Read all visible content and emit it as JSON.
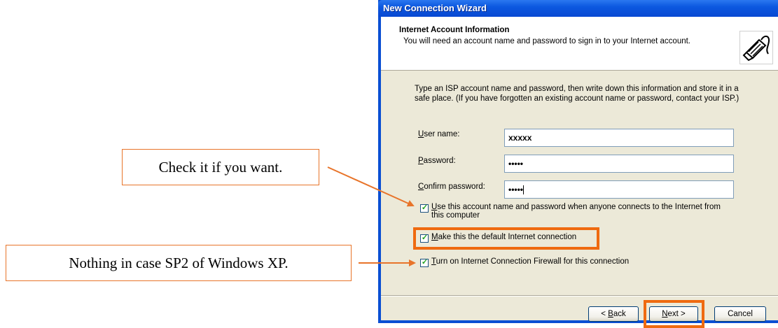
{
  "callouts": {
    "check_it": "Check it if you want.",
    "nothing_sp2": "Nothing in case SP2 of Windows XP."
  },
  "window": {
    "title": "New Connection Wizard"
  },
  "header": {
    "title": "Internet Account Information",
    "subtitle": "You will need an account name and password to sign in to your Internet account.",
    "icon": "phone-cable-icon"
  },
  "intro": {
    "line1": "Type an ISP account name and password, then write down this information and store it in a",
    "line2": "safe place. (If you have forgotten an existing account name or password, contact your ISP.)"
  },
  "fields": {
    "user_name": {
      "label_first": "U",
      "label_rest": "ser name:",
      "value": "xxxxx"
    },
    "password": {
      "label_first": "P",
      "label_rest": "assword:",
      "value": "•••••"
    },
    "confirm": {
      "label_first": "C",
      "label_rest": "onfirm password:",
      "value": "•••••"
    }
  },
  "checks": {
    "use_account": {
      "checked": true,
      "line1_first": "U",
      "line1_rest": "se this account  name and password when anyone connects to the Internet from",
      "line2": "this computer"
    },
    "default_connection": {
      "checked": true,
      "first": "M",
      "rest": "ake this the default Internet connection"
    },
    "firewall": {
      "checked": true,
      "first": "T",
      "rest": "urn on Internet Connection Firewall for this connection"
    }
  },
  "buttons": {
    "back_prefix": "< ",
    "back_first": "B",
    "back_rest": "ack",
    "next_first": "N",
    "next_rest": "ext",
    "next_suffix": " >",
    "cancel": "Cancel"
  },
  "colors": {
    "accent_highlight": "#ef6a10",
    "callout_border": "#e8742a",
    "xp_blue": "#0a4fd3",
    "dialog_bg": "#ece9d8"
  }
}
